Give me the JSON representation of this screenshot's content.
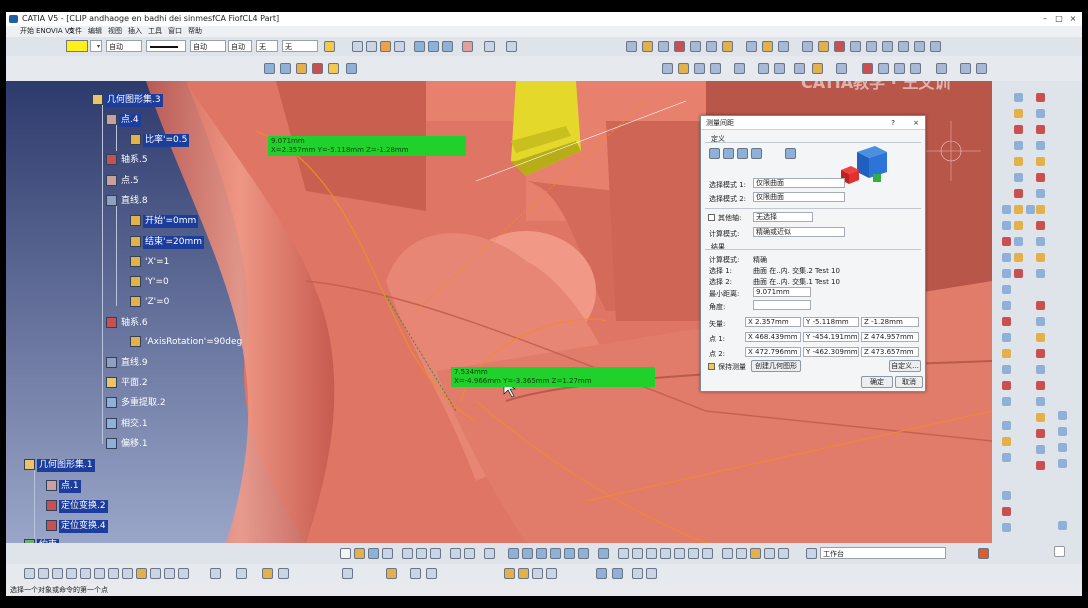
{
  "window": {
    "title": "CATIA V5 - [CLIP andhaoge en badhi dei sinmesfCA FiofCL4 Part]",
    "minimize": "–",
    "maximize": "□",
    "close": "×"
  },
  "menu": [
    "开始",
    "ENOVIA V5",
    "文件",
    "编辑",
    "视图",
    "插入",
    "工具",
    "窗口",
    "帮助"
  ],
  "toolbar": {
    "color_combo": "",
    "linetype_combo": "无",
    "line_combo": "",
    "layer_combo": "自动",
    "layer2_combo": "自动",
    "layer3_combo": "自动",
    "layer4_combo": "无"
  },
  "tree": [
    {
      "label": "几何图形集.3",
      "level": 0,
      "highlight": true
    },
    {
      "label": "点.4",
      "level": 1,
      "highlight": true
    },
    {
      "label": "比率'=0.5",
      "level": 2,
      "highlight": true
    },
    {
      "label": "轴系.5",
      "level": 1,
      "highlight": false
    },
    {
      "label": "点.5",
      "level": 1,
      "highlight": false
    },
    {
      "label": "直线.8",
      "level": 1,
      "highlight": false
    },
    {
      "label": "开始'=0mm",
      "level": 2,
      "highlight": true
    },
    {
      "label": "结束'=20mm",
      "level": 2,
      "highlight": true
    },
    {
      "label": "'X'=1",
      "level": 2,
      "highlight": false
    },
    {
      "label": "'Y'=0",
      "level": 2,
      "highlight": false
    },
    {
      "label": "'Z'=0",
      "level": 2,
      "highlight": false
    },
    {
      "label": "轴系.6",
      "level": 1,
      "highlight": false
    },
    {
      "label": "'AxisRotation'=90deg",
      "level": 2,
      "highlight": false
    },
    {
      "label": "直线.9",
      "level": 1,
      "highlight": false
    },
    {
      "label": "平面.2",
      "level": 1,
      "highlight": false
    },
    {
      "label": "多重提取.2",
      "level": 1,
      "highlight": false
    },
    {
      "label": "相交.1",
      "level": 1,
      "highlight": false
    },
    {
      "label": "偏移.1",
      "level": 1,
      "highlight": false
    },
    {
      "label": "几何图形集.1",
      "level": 0,
      "highlight": true
    },
    {
      "label": "点.1",
      "level": 1,
      "highlight": true
    },
    {
      "label": "定位变换.2",
      "level": 1,
      "highlight": true
    },
    {
      "label": "定位变换.4",
      "level": 1,
      "highlight": true
    },
    {
      "label": "约束",
      "level": 0,
      "highlight": true
    }
  ],
  "measure_labels": {
    "top_line1": "9.071mm",
    "top_line2": "X=2.357mm  Y=-5.118mm  Z=-1.28mm",
    "bottom_line1": "7.534mm",
    "bottom_line2": "X=-4.966mm  Y=-3.365mm  Z=1.27mm"
  },
  "dialog": {
    "title": "测量间距",
    "help": "?",
    "close": "×",
    "definition_label": "定义",
    "sel1_label": "选择模式 1:",
    "sel1_value": "仅限曲面",
    "sel2_label": "选择模式 2:",
    "sel2_value": "仅限曲面",
    "other_axis_label": "其他轴:",
    "other_axis_value": "无选择",
    "calc_mode_label": "计算模式:",
    "calc_mode_value": "精确或近似",
    "result_label": "结果",
    "r_calc_mode_label": "计算模式:",
    "r_calc_mode_value": "精确",
    "r_sel1_label": "选择 1:",
    "r_sel1_value": "曲面 在..内. 交集.2 Test 10",
    "r_sel2_label": "选择 2:",
    "r_sel2_value": "曲面 在..内. 交集.1 Test 10",
    "min_dist_label": "最小距离:",
    "min_dist_value": "9.071mm",
    "angle_label": "角度:",
    "angle_value": "",
    "delta_label": "矢量:",
    "delta_x": "X 2.357mm",
    "delta_y": "Y -5.118mm",
    "delta_z": "Z -1.28mm",
    "p1_label": "点 1:",
    "p1_x": "X 468.439mm",
    "p1_y": "Y -454.191mm",
    "p1_z": "Z 474.957mm",
    "p2_label": "点 2:",
    "p2_x": "X 472.796mm",
    "p2_y": "Y -462.309mm",
    "p2_z": "Z 473.657mm",
    "keep_label": "保持测量",
    "create_geom_button": "创建几何图形",
    "customize_button": "自定义...",
    "ok_button": "确定",
    "cancel_button": "取消"
  },
  "bottom_combo": "工作台",
  "status_text": "选择一个对象或命令的第一个点",
  "watermark": "CATIA教学 · 王文训",
  "colors": {
    "viewport_bg": "#2c3a6e",
    "part_surface": "#e07a6a",
    "measure_green": "#1fd12a",
    "edge_orange": "#f08a2a"
  }
}
